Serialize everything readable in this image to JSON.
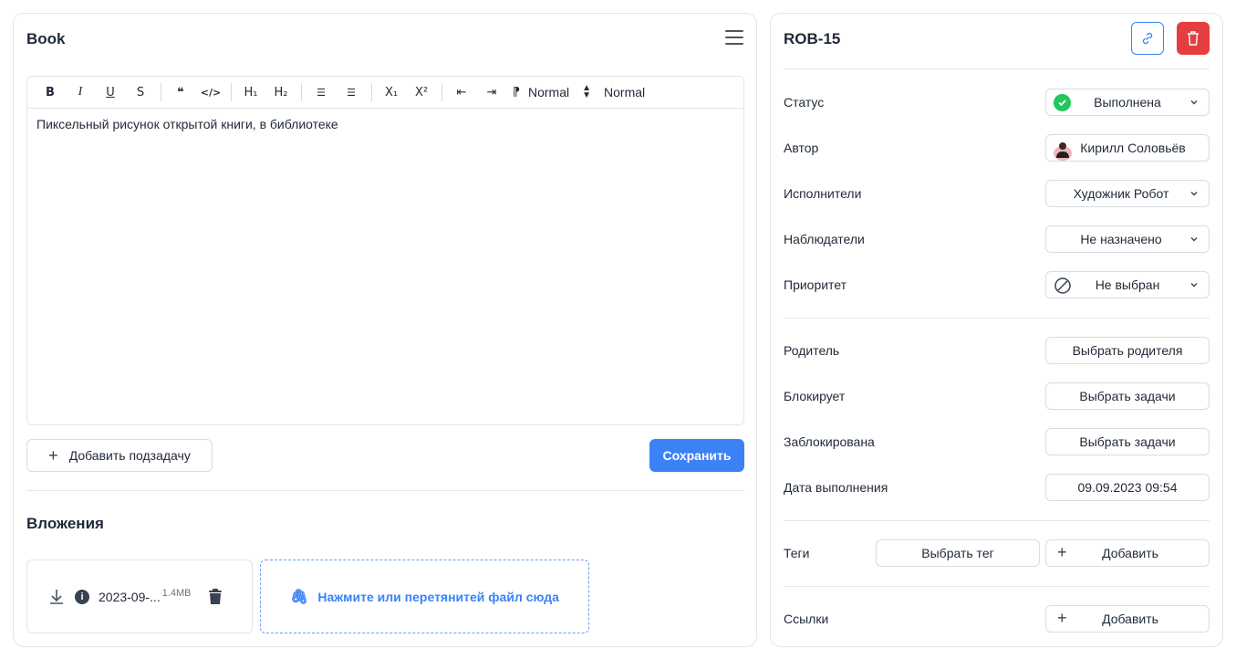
{
  "task": {
    "title": "Book",
    "description": "Пиксельный рисунок открытой книги, в библиотеке"
  },
  "editor_toolbar": {
    "bold": "B",
    "italic": "I",
    "underline": "U",
    "strike": "S",
    "quote": "❝",
    "code": "</>",
    "h1": "H₁",
    "h2": "H₂",
    "list_bullet": "☰",
    "list_ordered": "☰",
    "subscript": "X₁",
    "superscript": "X²",
    "outdent": "⇤",
    "indent": "⇥",
    "direction": "⁋",
    "font_size": "Normal",
    "header_select": "Normal"
  },
  "actions": {
    "add_subtask": "Добавить подзадачу",
    "save": "Сохранить"
  },
  "attachments": {
    "title": "Вложения",
    "files": [
      {
        "name": "2023-09-...",
        "size": "1.4MB"
      }
    ],
    "dropzone": "Нажмите или перетянитей файл сюда"
  },
  "details": {
    "key": "ROB-15",
    "status_label": "Статус",
    "status_value": "Выполнена",
    "author_label": "Автор",
    "author_value": "Кирилл Соловьёв",
    "assignees_label": "Исполнители",
    "assignees_value": "Художник Робот",
    "watchers_label": "Наблюдатели",
    "watchers_value": "Не назначено",
    "priority_label": "Приоритет",
    "priority_value": "Не выбран",
    "parent_label": "Родитель",
    "parent_value": "Выбрать родителя",
    "blocks_label": "Блокирует",
    "blocks_value": "Выбрать задачи",
    "blocked_label": "Заблокирована",
    "blocked_value": "Выбрать задачи",
    "due_label": "Дата выполнения",
    "due_value": "09.09.2023 09:54",
    "tags_label": "Теги",
    "tags_select": "Выбрать тег",
    "tags_add": "Добавить",
    "links_label": "Ссылки",
    "links_add": "Добавить"
  },
  "colors": {
    "primary": "#3b82f6",
    "danger": "#e53e3e",
    "success": "#22c55e"
  }
}
